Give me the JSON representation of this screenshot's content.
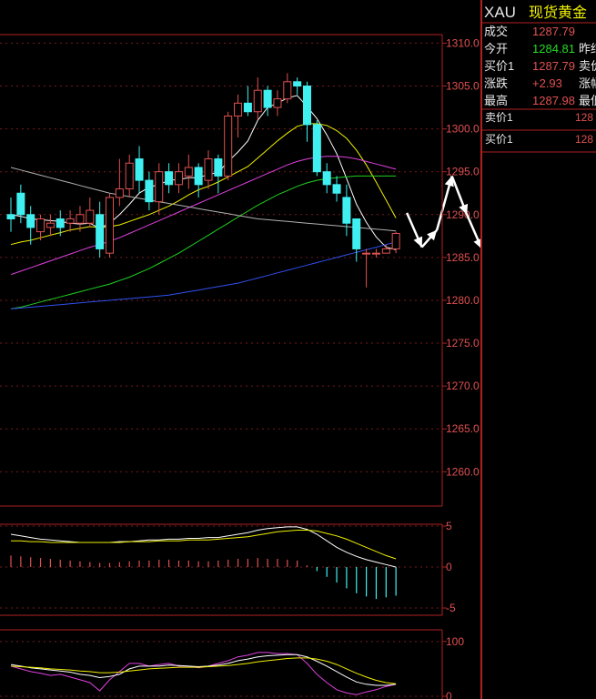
{
  "panel": {
    "symbol": "XAU",
    "name": "现货黄金",
    "quotes": [
      {
        "label": "成交",
        "value": "1287.79",
        "value_color": "#e05050",
        "right_label": ""
      },
      {
        "label": "今开",
        "value": "1284.81",
        "value_color": "#22dd22",
        "right_label": "昨结"
      },
      {
        "label": "买价1",
        "value": "1287.79",
        "value_color": "#e05050",
        "right_label": "卖价"
      },
      {
        "label": "涨跌",
        "value": "+2.93",
        "value_color": "#e05050",
        "right_label": "涨幅"
      },
      {
        "label": "最高",
        "value": "1287.98",
        "value_color": "#e05050",
        "right_label": "最低"
      }
    ],
    "sell_label": "卖价1",
    "sell_value": "128",
    "buy_label": "买价1",
    "buy_value": "128"
  },
  "colors": {
    "frame": "#b02020",
    "grid": "#7a1a1a",
    "up": "#e05050",
    "down": "#40f0f0",
    "ma5": "#ffffff",
    "ma10": "#f0f000",
    "ma20": "#e040e0",
    "ma40": "#20d020",
    "ma60": "#b0b0b0",
    "ma120": "#3050f0",
    "axis_text": "#e05050"
  },
  "chart_data": [
    {
      "type": "candlestick",
      "title": "",
      "ylim": [
        1256,
        1311
      ],
      "y_ticks": [
        "1310.0",
        "1305.0",
        "1300.0",
        "1295.0",
        "1290.0",
        "1285.0",
        "1280.0",
        "1275.0",
        "1270.0",
        "1265.0",
        "1260.0"
      ],
      "candles": [
        [
          1290.0,
          1289.5,
          1292.0,
          1288.0
        ],
        [
          1292.5,
          1290.0,
          1293.5,
          1289.0
        ],
        [
          1290.0,
          1288.5,
          1291.0,
          1286.5
        ],
        [
          1288.0,
          1289.5,
          1290.0,
          1287.0
        ],
        [
          1288.5,
          1289.0,
          1290.0,
          1287.5
        ],
        [
          1289.5,
          1288.5,
          1290.5,
          1287.5
        ],
        [
          1289.0,
          1289.5,
          1290.5,
          1288.0
        ],
        [
          1289.0,
          1290.0,
          1291.0,
          1288.0
        ],
        [
          1289.0,
          1290.5,
          1292.0,
          1288.5
        ],
        [
          1290.0,
          1286.0,
          1291.5,
          1285.0
        ],
        [
          1285.5,
          1292.0,
          1292.5,
          1285.0
        ],
        [
          1292.0,
          1293.0,
          1296.5,
          1291.0
        ],
        [
          1293.0,
          1296.0,
          1297.0,
          1292.0
        ],
        [
          1296.5,
          1294.0,
          1298.0,
          1292.5
        ],
        [
          1294.0,
          1291.5,
          1295.0,
          1290.5
        ],
        [
          1291.5,
          1295.0,
          1296.0,
          1290.0
        ],
        [
          1295.0,
          1293.5,
          1296.0,
          1292.5
        ],
        [
          1293.5,
          1295.0,
          1296.0,
          1292.5
        ],
        [
          1294.5,
          1295.5,
          1297.0,
          1293.0
        ],
        [
          1295.5,
          1293.5,
          1296.0,
          1292.0
        ],
        [
          1294.0,
          1296.5,
          1297.5,
          1293.0
        ],
        [
          1296.5,
          1294.5,
          1297.0,
          1292.5
        ],
        [
          1294.5,
          1301.5,
          1302.0,
          1294.0
        ],
        [
          1301.5,
          1303.0,
          1304.0,
          1299.0
        ],
        [
          1303.0,
          1302.0,
          1305.0,
          1301.5
        ],
        [
          1302.0,
          1304.5,
          1306.0,
          1301.0
        ],
        [
          1304.5,
          1302.5,
          1305.0,
          1301.5
        ],
        [
          1302.5,
          1303.5,
          1304.5,
          1301.5
        ],
        [
          1303.5,
          1305.5,
          1306.5,
          1303.0
        ],
        [
          1305.5,
          1305.0,
          1306.0,
          1304.0
        ],
        [
          1305.0,
          1300.5,
          1305.5,
          1298.5
        ],
        [
          1300.5,
          1295.0,
          1301.0,
          1294.5
        ],
        [
          1295.0,
          1293.5,
          1296.0,
          1292.5
        ],
        [
          1293.5,
          1292.5,
          1294.5,
          1291.5
        ],
        [
          1292.0,
          1289.0,
          1293.5,
          1287.5
        ],
        [
          1289.5,
          1286.0,
          1289.5,
          1284.5
        ],
        [
          1285.5,
          1285.5,
          1286.0,
          1281.5
        ],
        [
          1285.5,
          1285.5,
          1286.0,
          1285.0
        ],
        [
          1285.5,
          1286.0,
          1286.5,
          1285.5
        ],
        [
          1286.0,
          1287.8,
          1288.0,
          1285.5
        ]
      ],
      "ma_lines": [
        {
          "color": "#ffffff",
          "values": [
            1290.0,
            1289.8,
            1289.5,
            1289.4,
            1289.3,
            1289.2,
            1289.0,
            1288.9,
            1289.0,
            1288.4,
            1289.0,
            1290.0,
            1291.2,
            1292.5,
            1293.2,
            1293.5,
            1294.0,
            1294.1,
            1294.3,
            1294.3,
            1294.7,
            1294.9,
            1296.2,
            1297.3,
            1298.6,
            1301.0,
            1302.5,
            1303.0,
            1303.6,
            1303.9,
            1302.6,
            1301.2,
            1299.3,
            1297.1,
            1294.2,
            1291.2,
            1289.1,
            1287.4,
            1286.2,
            1285.9
          ]
        },
        {
          "color": "#f0f000",
          "values": [
            1286.5,
            1286.8,
            1287.0,
            1287.3,
            1287.6,
            1287.9,
            1288.2,
            1288.4,
            1288.6,
            1288.5,
            1288.6,
            1288.8,
            1289.2,
            1289.6,
            1290.0,
            1290.5,
            1291.0,
            1291.6,
            1292.3,
            1292.9,
            1293.3,
            1293.8,
            1294.4,
            1295.0,
            1295.6,
            1296.6,
            1297.6,
            1298.6,
            1299.5,
            1300.3,
            1300.6,
            1300.6,
            1300.4,
            1299.8,
            1298.9,
            1297.5,
            1295.8,
            1293.8,
            1291.7,
            1289.6
          ]
        },
        {
          "color": "#e040e0",
          "values": [
            1283.0,
            1283.4,
            1283.8,
            1284.2,
            1284.6,
            1285.0,
            1285.4,
            1285.8,
            1286.2,
            1286.5,
            1286.9,
            1287.3,
            1287.8,
            1288.3,
            1288.8,
            1289.3,
            1289.8,
            1290.3,
            1290.8,
            1291.3,
            1291.8,
            1292.3,
            1292.8,
            1293.3,
            1293.8,
            1294.3,
            1294.8,
            1295.3,
            1295.8,
            1296.2,
            1296.5,
            1296.7,
            1296.8,
            1296.8,
            1296.7,
            1296.5,
            1296.2,
            1295.9,
            1295.6,
            1295.3
          ]
        },
        {
          "color": "#20d020",
          "values": [
            1279.0,
            1279.2,
            1279.5,
            1279.8,
            1280.1,
            1280.4,
            1280.7,
            1281.0,
            1281.3,
            1281.6,
            1281.9,
            1282.3,
            1282.7,
            1283.2,
            1283.7,
            1284.3,
            1284.9,
            1285.5,
            1286.2,
            1286.9,
            1287.6,
            1288.3,
            1289.0,
            1289.7,
            1290.4,
            1291.1,
            1291.7,
            1292.3,
            1292.8,
            1293.3,
            1293.7,
            1294.0,
            1294.2,
            1294.3,
            1294.4,
            1294.5,
            1294.5,
            1294.5,
            1294.5,
            1294.5
          ]
        },
        {
          "color": "#b0b0b0",
          "values": [
            1295.5,
            1295.2,
            1294.9,
            1294.6,
            1294.3,
            1294.0,
            1293.7,
            1293.4,
            1293.1,
            1292.8,
            1292.5,
            1292.3,
            1292.1,
            1291.9,
            1291.7,
            1291.5,
            1291.3,
            1291.1,
            1290.9,
            1290.7,
            1290.5,
            1290.3,
            1290.1,
            1289.9,
            1289.7,
            1289.5,
            1289.4,
            1289.3,
            1289.2,
            1289.1,
            1289.0,
            1288.9,
            1288.8,
            1288.7,
            1288.6,
            1288.5,
            1288.4,
            1288.3,
            1288.2,
            1288.1
          ]
        },
        {
          "color": "#3050f0",
          "values": [
            1279.0,
            1279.1,
            1279.2,
            1279.3,
            1279.4,
            1279.5,
            1279.6,
            1279.7,
            1279.8,
            1279.9,
            1280.0,
            1280.1,
            1280.2,
            1280.3,
            1280.4,
            1280.5,
            1280.6,
            1280.8,
            1281.0,
            1281.2,
            1281.4,
            1281.6,
            1281.8,
            1282.0,
            1282.3,
            1282.6,
            1282.9,
            1283.2,
            1283.5,
            1283.8,
            1284.1,
            1284.4,
            1284.7,
            1285.0,
            1285.3,
            1285.6,
            1285.9,
            1286.2,
            1286.5,
            1286.8
          ]
        }
      ],
      "projection_arrows": [
        [
          1290.2,
          1286.2
        ],
        [
          1286.2,
          1288.2
        ],
        [
          1288.2,
          1294.5
        ],
        [
          1294.5,
          1290.0
        ],
        [
          1290.0,
          1286.0
        ],
        [
          1286.0,
          1276.5
        ]
      ]
    },
    {
      "type": "bar",
      "title": "",
      "ylim": [
        -5,
        5
      ],
      "y_ticks": [
        "5",
        "0",
        "-5"
      ],
      "values": [
        1.4,
        1.3,
        1.2,
        1.1,
        1.0,
        0.9,
        0.8,
        0.7,
        0.6,
        0.5,
        0.5,
        0.6,
        0.7,
        0.8,
        0.8,
        0.9,
        0.9,
        0.8,
        0.8,
        0.7,
        0.7,
        0.8,
        0.9,
        1.0,
        1.0,
        1.1,
        1.0,
        1.0,
        0.9,
        0.8,
        0.2,
        -0.5,
        -1.2,
        -1.9,
        -2.6,
        -3.2,
        -3.6,
        -3.9,
        -3.7,
        -3.5
      ],
      "lines": [
        {
          "color": "#ffffff",
          "values": [
            4.0,
            3.8,
            3.6,
            3.4,
            3.3,
            3.2,
            3.1,
            3.0,
            3.0,
            3.0,
            3.0,
            3.1,
            3.1,
            3.2,
            3.3,
            3.3,
            3.4,
            3.4,
            3.5,
            3.5,
            3.6,
            3.6,
            3.8,
            4.0,
            4.2,
            4.5,
            4.7,
            4.8,
            4.9,
            4.9,
            4.6,
            4.0,
            3.2,
            2.4,
            1.8,
            1.3,
            0.9,
            0.6,
            0.3,
            0.0
          ]
        },
        {
          "color": "#f0f000",
          "values": [
            3.2,
            3.2,
            3.1,
            3.1,
            3.0,
            3.0,
            3.0,
            3.0,
            3.0,
            3.0,
            3.0,
            3.0,
            3.1,
            3.1,
            3.1,
            3.2,
            3.2,
            3.2,
            3.3,
            3.3,
            3.3,
            3.4,
            3.5,
            3.6,
            3.7,
            3.9,
            4.1,
            4.3,
            4.4,
            4.5,
            4.5,
            4.4,
            4.1,
            3.8,
            3.4,
            2.9,
            2.4,
            1.9,
            1.4,
            1.0
          ]
        }
      ]
    },
    {
      "type": "line",
      "title": "",
      "ylim": [
        -5,
        118
      ],
      "y_ticks": [
        "100",
        "0"
      ],
      "lines": [
        {
          "color": "#e040e0",
          "values": [
            55,
            50,
            45,
            42,
            38,
            40,
            35,
            30,
            25,
            10,
            30,
            45,
            60,
            60,
            55,
            58,
            60,
            55,
            55,
            52,
            55,
            60,
            65,
            72,
            75,
            80,
            80,
            78,
            78,
            76,
            60,
            40,
            25,
            12,
            6,
            3,
            8,
            12,
            18,
            22
          ]
        },
        {
          "color": "#ffffff",
          "values": [
            58,
            55,
            52,
            50,
            48,
            46,
            44,
            40,
            38,
            34,
            36,
            40,
            50,
            55,
            55,
            55,
            57,
            56,
            55,
            54,
            55,
            57,
            60,
            65,
            68,
            72,
            74,
            75,
            76,
            76,
            72,
            64,
            55,
            45,
            35,
            26,
            22,
            20,
            20,
            22
          ]
        },
        {
          "color": "#f0f000",
          "values": [
            55,
            54,
            53,
            52,
            50,
            49,
            48,
            46,
            45,
            43,
            43,
            44,
            46,
            48,
            50,
            51,
            52,
            53,
            53,
            53,
            54,
            55,
            56,
            58,
            60,
            63,
            65,
            67,
            69,
            70,
            70,
            68,
            64,
            58,
            50,
            42,
            35,
            29,
            25,
            23
          ]
        }
      ]
    }
  ]
}
